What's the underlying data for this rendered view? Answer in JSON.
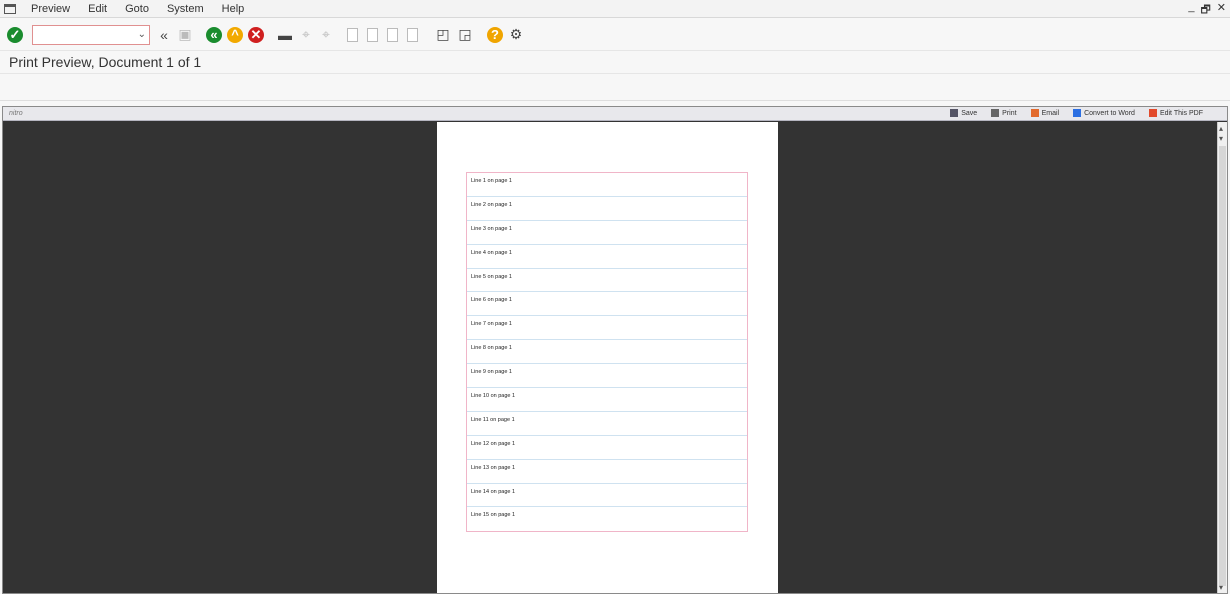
{
  "menu": {
    "items": [
      "Preview",
      "Edit",
      "Goto",
      "System",
      "Help"
    ]
  },
  "window_controls": {
    "minimize": "_",
    "restore": "🗗",
    "close": "✕"
  },
  "toolbar": {
    "command_field_value": "",
    "icons": [
      "enter-icon",
      "back-icon",
      "save-icon",
      "back-green-icon",
      "exit-icon",
      "cancel-icon",
      "print-icon",
      "find-icon",
      "find-next-icon",
      "first-page-icon",
      "previous-page-icon",
      "next-page-icon",
      "last-page-icon",
      "new-session-icon",
      "shortcut-icon",
      "help-icon",
      "settings-icon"
    ]
  },
  "title": "Print Preview, Document 1 of 1",
  "viewer": {
    "brand": "nitro",
    "actions": [
      "Save",
      "Print",
      "Email",
      "Convert to Word",
      "Edit This PDF"
    ]
  },
  "document": {
    "lines": [
      "Line 1  on page 1",
      "Line 2  on page 1",
      "Line 3  on page 1",
      "Line 4  on page 1",
      "Line 5  on page 1",
      "Line 6  on page 1",
      "Line 7  on page 1",
      "Line 8  on page 1",
      "Line 9  on page 1",
      "Line 10  on page 1",
      "Line 11  on page 1",
      "Line 12  on page 1",
      "Line 13  on page 1",
      "Line 14  on page 1",
      "Line 15  on page 1"
    ]
  },
  "colors": {
    "viewer_background": "#333333",
    "line_border": "#f0b5c8",
    "row_divider": "#cfe2f0"
  }
}
